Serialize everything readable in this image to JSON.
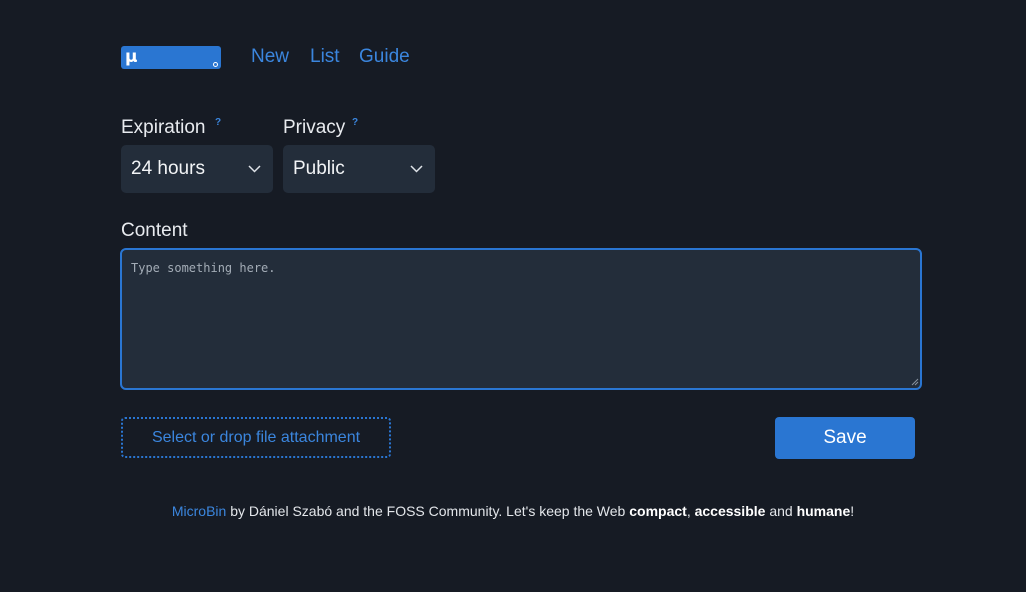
{
  "nav": {
    "logo_glyph": "μ",
    "links": [
      "New",
      "List",
      "Guide"
    ]
  },
  "form": {
    "expiration_label": "Expiration",
    "expiration_help": "?",
    "expiration_value": "24 hours",
    "privacy_label": "Privacy",
    "privacy_help": "?",
    "privacy_value": "Public",
    "content_label": "Content",
    "content_placeholder": "Type something here.",
    "attach_label": "Select or drop file attachment",
    "save_label": "Save"
  },
  "footer": {
    "brand": "MicroBin",
    "text1": " by Dániel Szabó and the FOSS Community. Let's keep the Web ",
    "w1": "compact",
    "sep1": ", ",
    "w2": "accessible",
    "sep2": " and ",
    "w3": "humane",
    "end": "!"
  },
  "colors": {
    "background": "#161b24",
    "accent": "#2a76d2",
    "field": "#232d3a"
  },
  "icons": [
    "logo-icon",
    "chevron-down-icon",
    "resize-grip-icon"
  ]
}
